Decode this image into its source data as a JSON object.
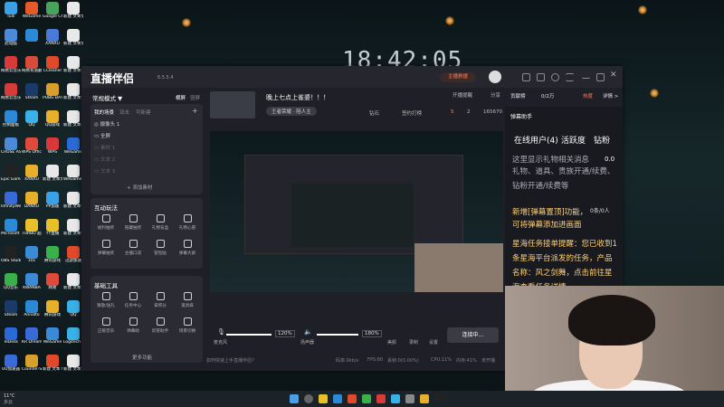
{
  "desktop": {
    "clock": "18:42:05",
    "icons": [
      {
        "label": "Tuili",
        "color": "#3aa1e6"
      },
      {
        "label": "WeGame",
        "color": "#e65a2a"
      },
      {
        "label": "Google Chrome",
        "color": "#4aa35a"
      },
      {
        "label": "新建 文本文档 (2).txt",
        "color": "#e8e8e8"
      },
      {
        "label": "此电脑",
        "color": "#4a8ad8"
      },
      {
        "label": "",
        "color": "#2a8ad8"
      },
      {
        "label": "XANXU",
        "color": "#4a7ad8"
      },
      {
        "label": "新建 文本文档.txt",
        "color": "#e8e8e8"
      },
      {
        "label": "网易云音乐",
        "color": "#d83a3a"
      },
      {
        "label": "网易有道翻译",
        "color": "#d84a3a"
      },
      {
        "label": "CCleaner",
        "color": "#e04a2a"
      },
      {
        "label": "新建 文本文档 (3).txt",
        "color": "#e8e8e8"
      },
      {
        "label": "网易云音乐",
        "color": "#d83a3a"
      },
      {
        "label": "Steam",
        "color": "#1a3a6a"
      },
      {
        "label": "PUBG BATTLEGROUNDS",
        "color": "#d8a02a"
      },
      {
        "label": "新建 文本文档 (4).txt",
        "color": "#e8e8e8"
      },
      {
        "label": "控制面板",
        "color": "#2a8ad8"
      },
      {
        "label": "QQ",
        "color": "#3ab0e8"
      },
      {
        "label": "QQ游戏",
        "color": "#e8b02a"
      },
      {
        "label": "新建 文本文档 (5).txt",
        "color": "#e8e8e8"
      },
      {
        "label": "CRUSE ASUS CPU-Z",
        "color": "#4a8ad8"
      },
      {
        "label": "WPS Office",
        "color": "#e04a3a"
      },
      {
        "label": "WPS",
        "color": "#d8383a"
      },
      {
        "label": "WeGame",
        "color": "#2a6ad8"
      },
      {
        "label": "Epic Games Launcher",
        "color": "#222222"
      },
      {
        "label": "XANXU",
        "color": "#e8b02a"
      },
      {
        "label": "新建 文本文档",
        "color": "#e8e8e8"
      },
      {
        "label": "WeGame 游戏",
        "color": "#e8e8e8"
      },
      {
        "label": "InfinityWeb Link Go",
        "color": "#3a6ad8"
      },
      {
        "label": "DANXU",
        "color": "#e8b02a"
      },
      {
        "label": "PP加速",
        "color": "#3aa1e6"
      },
      {
        "label": "新建 文本文档",
        "color": "#e8e8e8"
      },
      {
        "label": "Microsoft Edge",
        "color": "#2a8ad8"
      },
      {
        "label": "TURBO 超级",
        "color": "#e8c02a"
      },
      {
        "label": "YY直播",
        "color": "#e8c02a"
      },
      {
        "label": "新建 文本文档",
        "color": "#e8e8e8"
      },
      {
        "label": "OBS Studio",
        "color": "#222222"
      },
      {
        "label": "101",
        "color": "#3a8ad8"
      },
      {
        "label": "腾讯游戏",
        "color": "#3ab04a"
      },
      {
        "label": "迅游加速",
        "color": "#e04a2a"
      },
      {
        "label": "QQ音乐",
        "color": "#3ab04a"
      },
      {
        "label": "KWANBA",
        "color": "#3a8ad8"
      },
      {
        "label": "网易",
        "color": "#e04a3a"
      },
      {
        "label": "新建 文本文档",
        "color": "#e8e8e8"
      },
      {
        "label": "Steam",
        "color": "#1a3a6a"
      },
      {
        "label": "Annalto",
        "color": "#2a8ad8"
      },
      {
        "label": "腾讯游戏",
        "color": "#e8b02a"
      },
      {
        "label": "QQ",
        "color": "#3ab0e8"
      },
      {
        "label": "TeDesk",
        "color": "#2a6ad8"
      },
      {
        "label": "KR Dream Hub",
        "color": "#3a6ad8"
      },
      {
        "label": "WeGame",
        "color": "#3a8ad8"
      },
      {
        "label": "Logitech G HUB",
        "color": "#3ab0e8"
      },
      {
        "label": "UU加速器",
        "color": "#3a6ad8"
      },
      {
        "label": "Counter-St...",
        "color": "#d8a02a"
      },
      {
        "label": "新建 文本 WeGame",
        "color": "#e04a2a"
      },
      {
        "label": "新建 文本文档",
        "color": "#e8e8e8"
      }
    ],
    "taskbar": {
      "weather": "11°C",
      "weather_sub": "多云"
    }
  },
  "app": {
    "name": "直播伴侣",
    "version": "6.5.5.4",
    "anchor_button": "主播救援",
    "mode": {
      "label": "常规模式 ▼",
      "orientation": "横屏",
      "orientation2": "竖屏"
    },
    "scene_tabs": [
      "我的场景",
      "双击",
      "可新建"
    ],
    "sources": [
      {
        "label": "摄像头 1",
        "active": true
      },
      {
        "label": "全屏",
        "active": true
      },
      {
        "label": "素材 1",
        "active": false
      },
      {
        "label": "文本 2",
        "active": false
      },
      {
        "label": "文本 3",
        "active": false
      },
      {
        "label": "文本 4",
        "active": false
      }
    ],
    "add_source": "+ 添加素材",
    "interactive": {
      "title": "互动玩法",
      "tools": [
        "福利抽奖",
        "隐藏抽奖",
        "礼物盲盒",
        "礼物心愿",
        "弹幕抽奖",
        "主播口袋",
        "冒险贴",
        "弹幕大屏"
      ]
    },
    "basic": {
      "title": "基础工具",
      "tools": [
        "猜歌/送礼",
        "任务中心",
        "拿积分",
        "道具排",
        "正版音乐",
        "弹幕助",
        "房管助手",
        "场景切换"
      ]
    },
    "more_tools": "更多功能",
    "stream_title": "晚上七点上雀婆！！！",
    "category_tag": "王者荣耀 · 陪人主",
    "stats": {
      "diamonds": "钻石",
      "likes": "5",
      "viewers": "2",
      "fans": "165670",
      "goal_label": "签约打榜"
    },
    "top_actions": [
      "开播提醒",
      "分享"
    ],
    "audio": {
      "mic_label": "麦克风",
      "mic_value": "120%",
      "mic_fill": 1.0,
      "speaker_label": "扬声器",
      "speaker_value": "180%",
      "speaker_fill": 1.0
    },
    "bottom_buttons": [
      "美颜",
      "录制",
      "设置"
    ],
    "go_live": "连接中...",
    "status": {
      "tip": "如何快速上手直播伴侣?",
      "bitrate": "码率:0kb/s",
      "fps": "FPS:60",
      "drop": "丢帧:0(0.00%)",
      "cpu": "CPU:11%",
      "mem": "内存:41%",
      "state": "未开播"
    }
  },
  "right": {
    "tabs": [
      "贡献榜",
      "0/2万",
      "热度",
      "详情 >"
    ],
    "danmu_title": "弹幕助手",
    "online": "在线用户(4)",
    "active": "活跃度",
    "diamond": "钻粉",
    "notice": "这里显示礼物相关消息",
    "notice2": "礼物、道具、贵族开通/续费、钻粉开通/续费等",
    "msg1": "新增[弹幕置顶]功能，可将弹幕添加进画面",
    "msg2": "星海任务接单提醒：您已收到1条星海平台派发的任务，产品名称：风之剑舞，点击前往星海查看任务详情",
    "rate": "0条/0人",
    "count": "0.0"
  }
}
